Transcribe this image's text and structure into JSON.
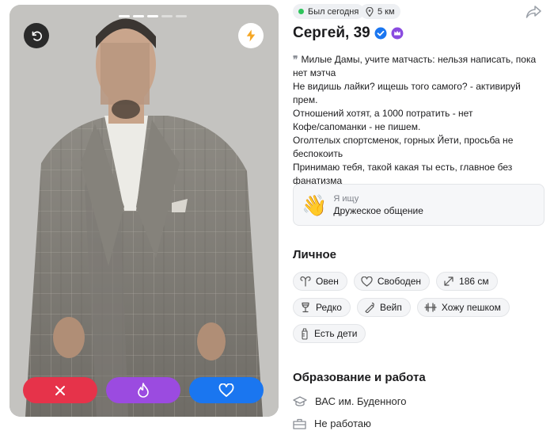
{
  "photo": {
    "progress": {
      "total": 5,
      "current": 3
    }
  },
  "status": {
    "online_label": "Был сегодня",
    "online_color": "#2ec45b",
    "distance": "5 км"
  },
  "profile": {
    "name": "Сергей, 39",
    "badges": [
      "verified-icon",
      "premium-crown-icon"
    ]
  },
  "bio": {
    "text": "Милые Дамы, учите матчасть: нельзя написать, пока нет мэтча\nНе видишь лайки? ищешь того самого? - активируй прем.\nОтношений хотят, а 1000 потратить - нет\nКофе/сапоманки - не пишем.\nОголтелых спортсменок, горных Йети, просьба не беспокоить\nПринимаю тебя, такой какая ты есть, главное без фанатизма"
  },
  "seeking": {
    "label": "Я ищу",
    "value": "Дружеское общение"
  },
  "personal": {
    "title": "Личное",
    "tags": [
      {
        "icon": "zodiac-aries-icon",
        "label": "Овен"
      },
      {
        "icon": "heart-outline-icon",
        "label": "Свободен"
      },
      {
        "icon": "height-arrows-icon",
        "label": "186 см"
      },
      {
        "icon": "wine-glass-icon",
        "label": "Редко"
      },
      {
        "icon": "vape-icon",
        "label": "Вейп"
      },
      {
        "icon": "dumbbell-icon",
        "label": "Хожу пешком"
      },
      {
        "icon": "baby-bottle-icon",
        "label": "Есть дети"
      }
    ]
  },
  "education_work": {
    "title": "Образование и работа",
    "education": "ВАС им. Буденного",
    "work": "Не работаю"
  },
  "colors": {
    "dislike": "#e6334a",
    "super_like": "#9b4be0",
    "like": "#1a76f0",
    "verified": "#1a76f0",
    "premium": "#8a4be0"
  }
}
